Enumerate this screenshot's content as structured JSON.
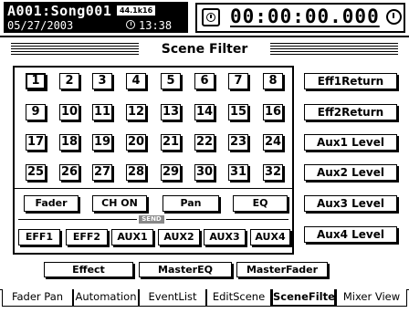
{
  "header": {
    "song_title": "A001:Song001",
    "sample_rate": "44.1k16",
    "date": "05/27/2003",
    "clock": "13:38",
    "counter": "00:00:00.000",
    "timer_icon": "timer-icon",
    "alarm_icon": "alarm-icon"
  },
  "screen": {
    "title": "Scene Filter"
  },
  "tracks": [
    "1",
    "2",
    "3",
    "4",
    "5",
    "6",
    "7",
    "8",
    "9",
    "10",
    "11",
    "12",
    "13",
    "14",
    "15",
    "16",
    "17",
    "18",
    "19",
    "20",
    "21",
    "22",
    "23",
    "24",
    "25",
    "26",
    "27",
    "28",
    "29",
    "30",
    "31",
    "32"
  ],
  "selected_track": "1",
  "params": [
    "Fader",
    "CH ON",
    "Pan",
    "EQ"
  ],
  "send_label": "SEND",
  "sends": [
    "EFF1",
    "EFF2",
    "AUX1",
    "AUX2",
    "AUX3",
    "AUX4"
  ],
  "side_buttons": [
    "Eff1Return",
    "Eff2Return",
    "Aux1 Level",
    "Aux2 Level",
    "Aux3 Level",
    "Aux4 Level"
  ],
  "bottom_buttons": [
    "Effect",
    "MasterEQ",
    "MasterFader"
  ],
  "tabs": [
    "Fader Pan",
    "Automation",
    "EventList",
    "EditScene",
    "SceneFilter",
    "Mixer View"
  ],
  "active_tab": "SceneFilter"
}
